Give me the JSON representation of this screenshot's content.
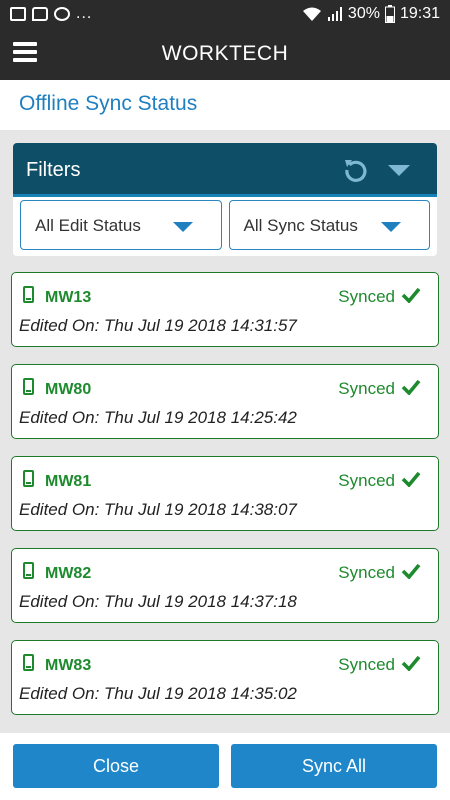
{
  "status_bar": {
    "left_icons": [
      "image-icon",
      "chat-icon",
      "video-icon"
    ],
    "overflow": "...",
    "battery_percent": "30%",
    "time": "19:31"
  },
  "app_bar": {
    "title": "WORKTECH"
  },
  "page": {
    "title": "Offline Sync Status"
  },
  "filters": {
    "label": "Filters",
    "edit_status": "All Edit Status",
    "sync_status": "All Sync Status"
  },
  "items": [
    {
      "id": "MW13",
      "status": "Synced",
      "edited": "Edited On: Thu Jul 19 2018 14:31:57"
    },
    {
      "id": "MW80",
      "status": "Synced",
      "edited": "Edited On: Thu Jul 19 2018 14:25:42"
    },
    {
      "id": "MW81",
      "status": "Synced",
      "edited": "Edited On: Thu Jul 19 2018 14:38:07"
    },
    {
      "id": "MW82",
      "status": "Synced",
      "edited": "Edited On: Thu Jul 19 2018 14:37:18"
    },
    {
      "id": "MW83",
      "status": "Synced",
      "edited": "Edited On: Thu Jul 19 2018 14:35:02"
    }
  ],
  "buttons": {
    "close": "Close",
    "sync_all": "Sync All"
  },
  "colors": {
    "app_bar": "#2b2b2b",
    "accent": "#1f87c9",
    "filters_header": "#0e4e66",
    "synced_green": "#1e8a2e"
  }
}
